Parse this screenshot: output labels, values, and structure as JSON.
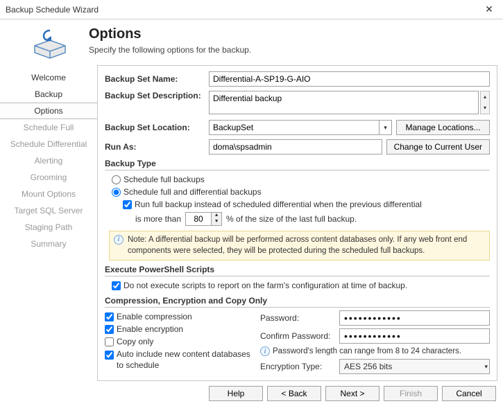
{
  "window": {
    "title": "Backup Schedule Wizard"
  },
  "header": {
    "title": "Options",
    "subtitle": "Specify the following options for the backup."
  },
  "sidebar": {
    "items": [
      {
        "label": "Welcome",
        "state": "enabled"
      },
      {
        "label": "Backup",
        "state": "enabled"
      },
      {
        "label": "Options",
        "state": "active"
      },
      {
        "label": "Schedule Full",
        "state": "disabled"
      },
      {
        "label": "Schedule Differential",
        "state": "disabled"
      },
      {
        "label": "Alerting",
        "state": "disabled"
      },
      {
        "label": "Grooming",
        "state": "disabled"
      },
      {
        "label": "Mount Options",
        "state": "disabled"
      },
      {
        "label": "Target SQL Server",
        "state": "disabled"
      },
      {
        "label": "Staging Path",
        "state": "disabled"
      },
      {
        "label": "Summary",
        "state": "disabled"
      }
    ]
  },
  "form": {
    "name_label": "Backup Set Name:",
    "name_value": "Differential-A-SP19-G-AIO",
    "desc_label": "Backup Set Description:",
    "desc_value": "Differential backup",
    "loc_label": "Backup Set Location:",
    "loc_value": "BackupSet",
    "manage_btn": "Manage Locations...",
    "runas_label": "Run As:",
    "runas_value": "doma\\spsadmin",
    "change_user_btn": "Change to Current User"
  },
  "backup_type": {
    "section": "Backup Type",
    "opt_full": "Schedule full backups",
    "opt_diff": "Schedule full and differential backups",
    "run_full_prefix": "Run full backup instead of scheduled differential when the previous differential",
    "run_full_mid1": "is more than",
    "run_full_pct": "80",
    "run_full_mid2": "% of the size of the last full backup.",
    "note": "Note: A differential backup will be performed across content databases only. If any web front end components were selected, they will be protected during the scheduled full backups."
  },
  "ps": {
    "section": "Execute PowerShell Scripts",
    "check_label": "Do not execute scripts to report on the farm's configuration at time of backup."
  },
  "cec": {
    "section": "Compression, Encryption and Copy Only",
    "compress": "Enable compression",
    "encrypt": "Enable encryption",
    "copyonly": "Copy only",
    "autoinc": "Auto include new content databases to schedule",
    "pw_label": "Password:",
    "pw_value": "●●●●●●●●●●●●",
    "cpw_label": "Confirm Password:",
    "cpw_value": "●●●●●●●●●●●●",
    "hint": "Password's length can range from 8 to 24 characters.",
    "enc_type_label": "Encryption Type:",
    "enc_type_value": "AES 256 bits"
  },
  "footer": {
    "help": "Help",
    "back": "< Back",
    "next": "Next >",
    "finish": "Finish",
    "cancel": "Cancel"
  }
}
